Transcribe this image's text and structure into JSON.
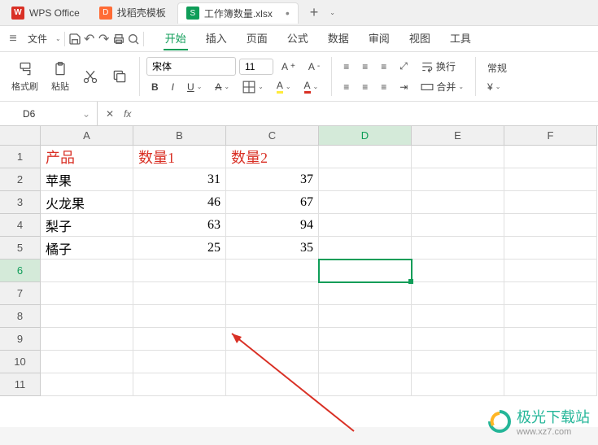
{
  "tabs": {
    "wps": "WPS Office",
    "template": "找稻壳模板",
    "workbook": "工作簿数量.xlsx"
  },
  "quickbar": {
    "file_menu": "文件"
  },
  "ribbon": {
    "start": "开始",
    "insert": "插入",
    "page": "页面",
    "formula": "公式",
    "data": "数据",
    "review": "审阅",
    "view": "视图",
    "tools": "工具"
  },
  "toolbar": {
    "format_painter": "格式刷",
    "paste": "粘贴",
    "font": "宋体",
    "font_size": "11",
    "wrap": "换行",
    "merge": "合并",
    "normal": "常规"
  },
  "formula_bar": {
    "name_box": "D6",
    "fx": "fx"
  },
  "grid": {
    "columns": [
      "A",
      "B",
      "C",
      "D",
      "E",
      "F"
    ],
    "rows": [
      "1",
      "2",
      "3",
      "4",
      "5",
      "6",
      "7",
      "8",
      "9",
      "10",
      "11"
    ],
    "selected_col": "D",
    "selected_row": "6"
  },
  "chart_data": {
    "type": "table",
    "headers": [
      "产品",
      "数量1",
      "数量2"
    ],
    "rows": [
      [
        "苹果",
        31,
        37
      ],
      [
        "火龙果",
        46,
        67
      ],
      [
        "梨子",
        63,
        94
      ],
      [
        "橘子",
        25,
        35
      ]
    ]
  },
  "watermark": {
    "title": "极光下载站",
    "url": "www.xz7.com"
  }
}
